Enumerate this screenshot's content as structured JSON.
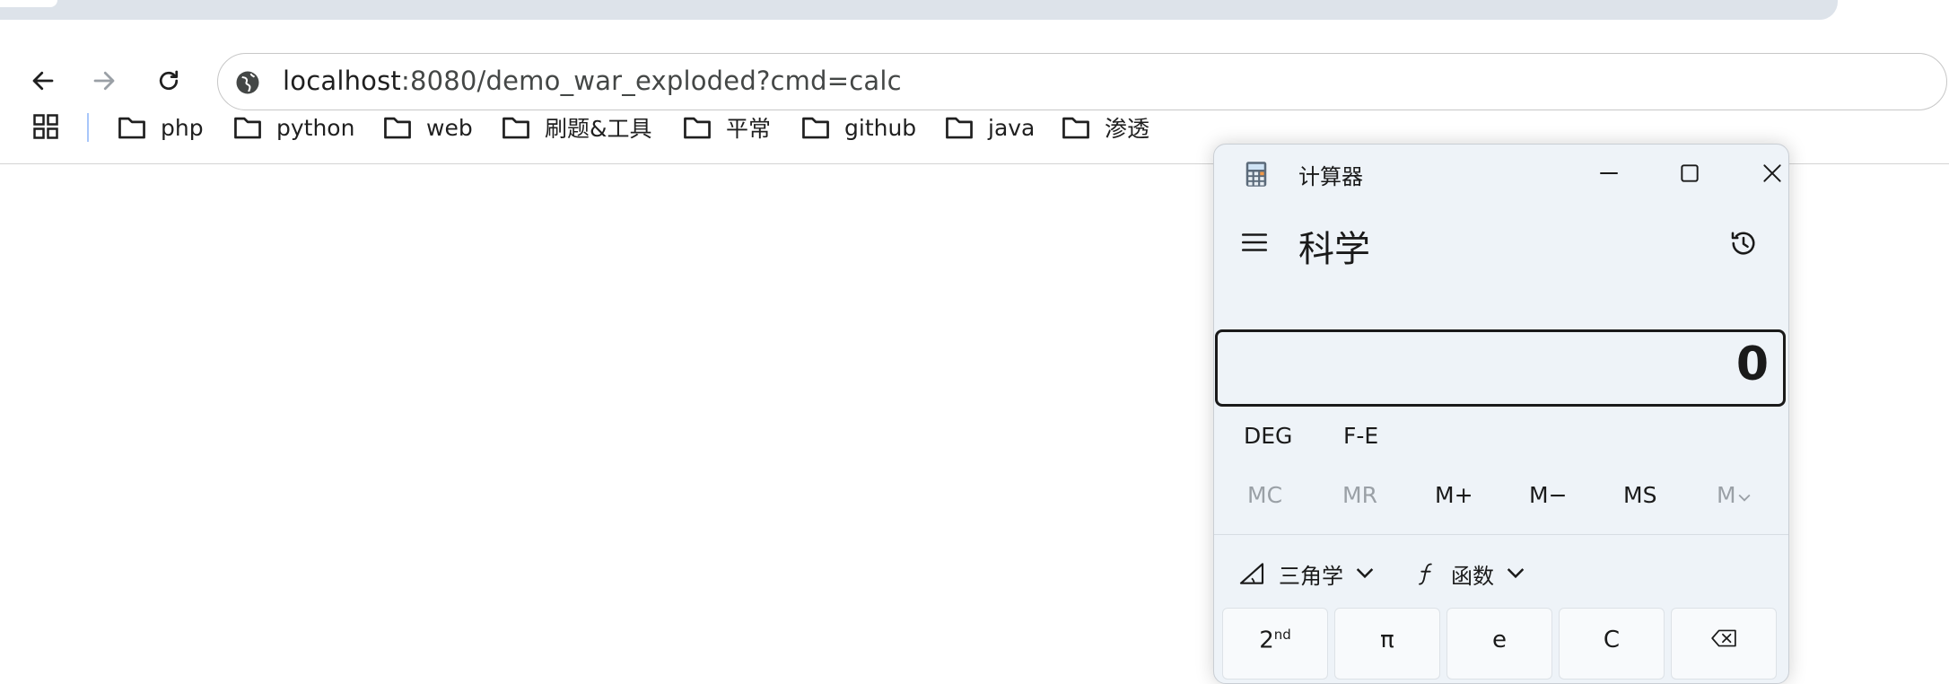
{
  "browser": {
    "nav": {
      "back_icon": "arrow-left-icon",
      "forward_icon": "arrow-right-icon",
      "reload_icon": "reload-icon"
    },
    "omnibox": {
      "host": "localhost",
      "rest": ":8080/demo_war_exploded?cmd=calc",
      "site_icon": "globe-icon"
    },
    "bookmarks": [
      {
        "label": "php"
      },
      {
        "label": "python"
      },
      {
        "label": "web"
      },
      {
        "label": "刷题&工具"
      },
      {
        "label": "平常"
      },
      {
        "label": "github"
      },
      {
        "label": "java"
      },
      {
        "label": "渗透"
      }
    ],
    "colors": {
      "tab_strip": "#dde3ea",
      "bookmark_separator": "#a8c7fa",
      "omnibox_border": "#c7c7c7"
    }
  },
  "calculator": {
    "title": "计算器",
    "mode": "科学",
    "display_value": "0",
    "angle_unit": "DEG",
    "notation": "F-E",
    "memory": {
      "mc": "MC",
      "mr": "MR",
      "mplus": "M+",
      "mminus": "M−",
      "ms": "MS",
      "mlist": "M"
    },
    "trig_label": "三角学",
    "func_label": "函数",
    "keys": {
      "second": "2",
      "second_sup": "nd",
      "pi": "π",
      "e": "e",
      "clear": "C"
    },
    "colors": {
      "background": "#eef3f8",
      "display_border": "#1a1a1a",
      "disabled_text": "#9aa0a6"
    }
  }
}
